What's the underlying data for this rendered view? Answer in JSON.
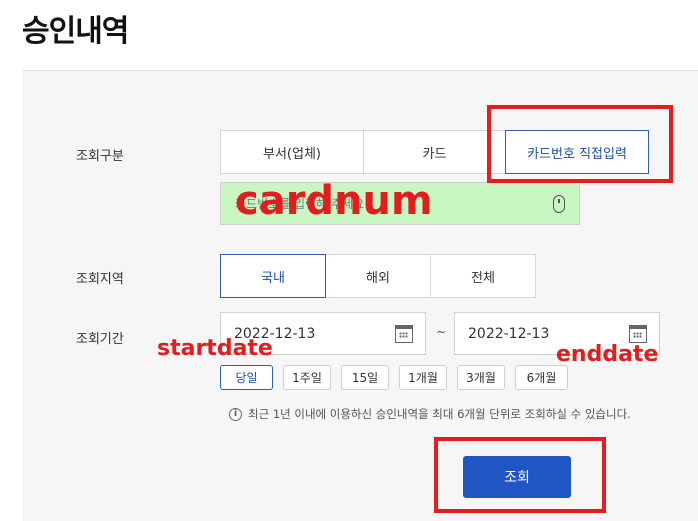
{
  "page_title": "승인내역",
  "search_type": {
    "label": "조회구분",
    "options": [
      "부서(업체)",
      "카드",
      "카드번호 직접입력"
    ],
    "selected": "카드번호 직접입력"
  },
  "card_input": {
    "placeholder": "카드번호를 입력해 주세요",
    "value": ""
  },
  "region": {
    "label": "조회지역",
    "options": [
      "국내",
      "해외",
      "전체"
    ],
    "selected": "국내"
  },
  "period": {
    "label": "조회기간",
    "start_date": "2022-12-13",
    "end_date": "2022-12-13",
    "separator": "~",
    "quick_options": [
      "당일",
      "1주일",
      "15일",
      "1개월",
      "3개월",
      "6개월"
    ],
    "selected": "당일"
  },
  "notice": "최근 1년 이내에 이용하신 승인내역을 최대 6개월 단위로 조회하실 수 있습니다.",
  "submit_label": "조회",
  "annotations": {
    "cardnum": "cardnum",
    "startdate": "startdate",
    "enddate": "enddate"
  },
  "colors": {
    "accent": "#1f56c4",
    "annotation": "#e41e1e",
    "card_highlight": "#c9f7c4"
  }
}
